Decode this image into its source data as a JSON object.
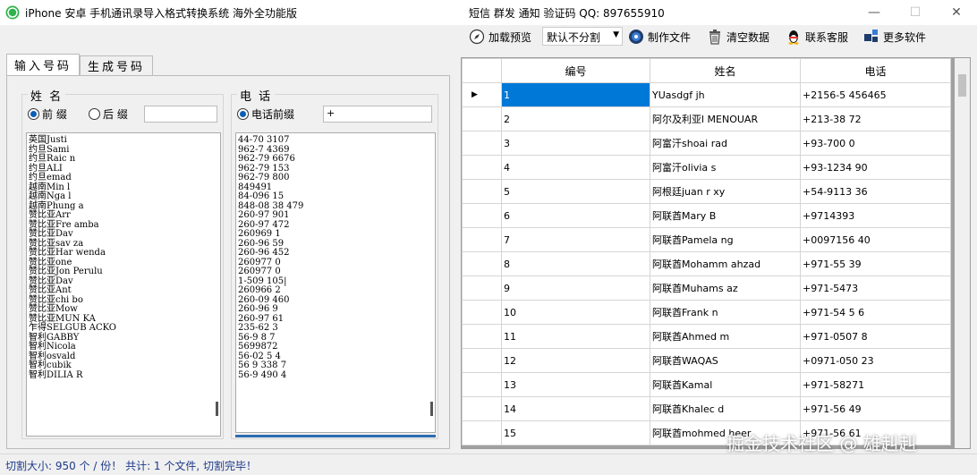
{
  "window": {
    "title": "iPhone 安卓 手机通讯录导入格式转换系统  海外全功能版",
    "contact": "短信 群发 通知 验证码   QQ:  897655910",
    "minimize": "—",
    "maximize": "☐",
    "close": "✕"
  },
  "toolbar": {
    "load_preview": "加载预览",
    "split_mode": "默认不分割",
    "make_file": "制作文件",
    "clear_data": "清空数据",
    "contact_service": "联系客服",
    "more_software": "更多软件"
  },
  "tabs": [
    {
      "label": "输入号码"
    },
    {
      "label": "生成号码"
    }
  ],
  "name_group": {
    "label": "姓 名",
    "prefix": "前 缀",
    "suffix": "后 缀",
    "suffix_value": ""
  },
  "phone_group": {
    "label": "电 话",
    "prefix": "电话前缀",
    "prefix_value": "+"
  },
  "names": [
    "英国Justi",
    "约旦Sami",
    "约旦Raic          n",
    "约旦ALI",
    "约旦emad",
    "越南Min l",
    "越南Nga l",
    "越南Phung          a",
    "赞比亚Arr",
    "赞比亚Fre          amba",
    "赞比亚Dav",
    "赞比亚sav          za",
    "赞比亚Har          wenda",
    "赞比亚one",
    "赞比亚Jon          Perulu",
    "赞比亚Dav",
    "赞比亚Ant",
    "赞比亚chi          bo",
    "赞比亚Mow",
    "赞比亚MUN          KA",
    "乍得SELGUB          ACKO",
    "智利GABBY",
    "智利Nicola",
    "智利osvald",
    "智利cubik",
    "智利DILIA R"
  ],
  "phones": [
    "44-70       3107",
    "962-7        4369",
    "962-79       6676",
    "962-79       153",
    "962-79       800",
    "849491",
    "84-096       15",
    "848-08       38 479",
    "260-97       901",
    "260-97       472",
    "260969       1",
    "260-96       59",
    "260-96       452",
    "260977       0",
    "260977       0",
    "1-509        105|",
    "260966       2",
    "260-09       460",
    "260-96       9",
    "260-97       61",
    "235-62       3",
    "56-9 8       7",
    "5699872",
    "56-02 5       4",
    "56 9 338     7",
    "56-9 490      4"
  ],
  "grid": {
    "headers": [
      "编号",
      "姓名",
      "电话"
    ],
    "rows": [
      {
        "no": "1",
        "name": "YUasdgf jh",
        "phone": "+2156-5         456465"
      },
      {
        "no": "2",
        "name": "阿尔及利亚l        MENOUAR",
        "phone": "+213-38         72"
      },
      {
        "no": "3",
        "name": "阿富汗shoai        rad",
        "phone": "+93-700         0"
      },
      {
        "no": "4",
        "name": "阿富汗olivia       s",
        "phone": "+93-1234        90"
      },
      {
        "no": "5",
        "name": "阿根廷juan r       xy",
        "phone": "+54-9113        36"
      },
      {
        "no": "6",
        "name": "阿联酋Mary B",
        "phone": "+9714393"
      },
      {
        "no": "7",
        "name": "阿联酋Pamela       ng",
        "phone": "+0097156         40"
      },
      {
        "no": "8",
        "name": "阿联酋Mohamm       ahzad",
        "phone": "+971-55         39"
      },
      {
        "no": "9",
        "name": "阿联酋Muhams       az",
        "phone": "+971-5473"
      },
      {
        "no": "10",
        "name": "阿联酋Frank        n",
        "phone": "+971-54 5        6"
      },
      {
        "no": "11",
        "name": "阿联酋Ahmed        m",
        "phone": "+971-0507         8"
      },
      {
        "no": "12",
        "name": "阿联酋WAQAS",
        "phone": "+0971-050        23"
      },
      {
        "no": "13",
        "name": "阿联酋Kamal",
        "phone": "+971-58271"
      },
      {
        "no": "14",
        "name": "阿联酋Khalec       d",
        "phone": "+971-56 49"
      },
      {
        "no": "15",
        "name": "阿联酋mohmed       heer",
        "phone": "+971-56 61"
      }
    ]
  },
  "status": {
    "text": "切割大小: 950 个 / 份！  共计: 1 个文件, 切割完毕！"
  },
  "watermark": "掘金技术社区 @ 雄赳赳",
  "colors": {
    "selection": "#0078d7",
    "status_text": "#1e3a8a",
    "radio_fill": "#0a5fb5"
  }
}
